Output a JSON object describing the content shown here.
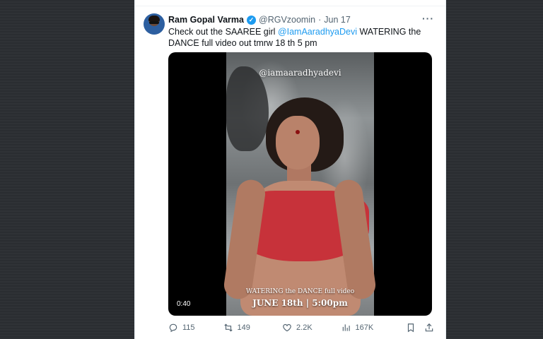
{
  "tweet": {
    "author_name": "Ram Gopal Varma",
    "verified_mark": "✓",
    "handle": "@RGVzoomin",
    "separator": "·",
    "date": "Jun 17",
    "more_label": "···",
    "text_before": "Check out the SAAREE girl ",
    "mention": "@IamAaradhyaDevi",
    "text_after": " WATERING the DANCE full video out tmrw 18 th 5 pm"
  },
  "media": {
    "watermark": "@iamaaradhyadevi",
    "caption_line1": "WATERING the DANCE full video",
    "caption_line2": "JUNE 18th | 5:00pm",
    "duration": "0:40"
  },
  "actions": {
    "replies": "115",
    "retweets": "149",
    "likes": "2.2K",
    "views": "167K"
  },
  "icons": [
    "reply-icon",
    "retweet-icon",
    "like-icon",
    "views-icon",
    "bookmark-icon",
    "share-icon",
    "more-icon",
    "verified-icon"
  ],
  "colors": {
    "accent": "#1d9bf0",
    "text": "#0f1419",
    "muted": "#536471"
  }
}
